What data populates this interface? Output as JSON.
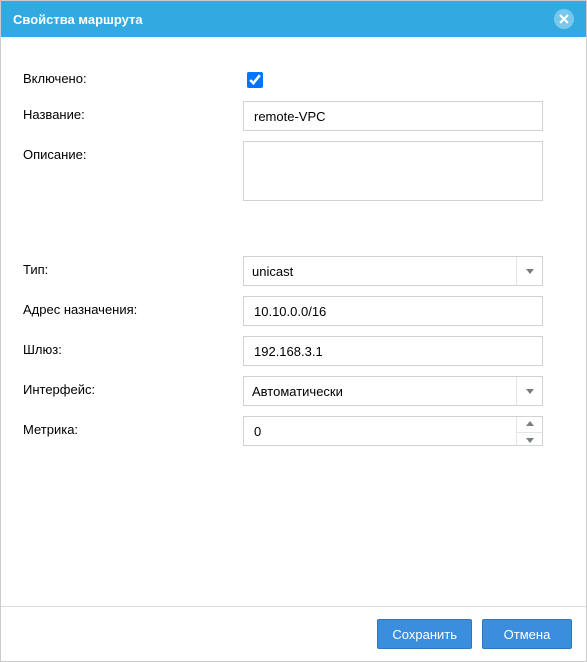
{
  "dialog": {
    "title": "Свойства маршрута"
  },
  "fields": {
    "enabled": {
      "label": "Включено:",
      "value": true
    },
    "name": {
      "label": "Название:",
      "value": "remote-VPC"
    },
    "description": {
      "label": "Описание:",
      "value": ""
    },
    "type": {
      "label": "Тип:",
      "value": "unicast"
    },
    "destination": {
      "label": "Адрес назначения:",
      "value": "10.10.0.0/16"
    },
    "gateway": {
      "label": "Шлюз:",
      "value": "192.168.3.1"
    },
    "interface": {
      "label": "Интерфейс:",
      "value": "Автоматически"
    },
    "metric": {
      "label": "Метрика:",
      "value": "0"
    }
  },
  "buttons": {
    "save": "Сохранить",
    "cancel": "Отмена"
  }
}
